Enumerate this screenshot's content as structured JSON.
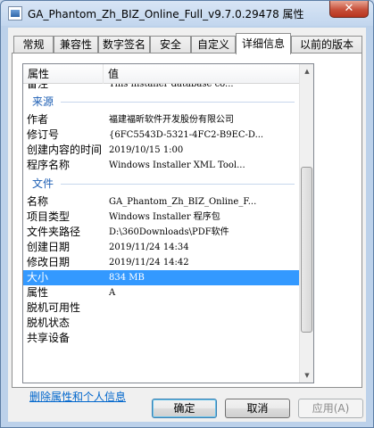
{
  "window": {
    "title": "GA_Phantom_Zh_BIZ_Online_Full_v9.7.0.29478 属性",
    "close_label": "✕"
  },
  "tabs": [
    {
      "label": "常规"
    },
    {
      "label": "兼容性"
    },
    {
      "label": "数字签名"
    },
    {
      "label": "安全"
    },
    {
      "label": "自定义"
    },
    {
      "label": "详细信息",
      "active": true
    },
    {
      "label": "以前的版本"
    }
  ],
  "list": {
    "header": {
      "property": "属性",
      "value": "值"
    },
    "partial_row": {
      "key": "备注",
      "value": "This installer database co..."
    },
    "groups": [
      {
        "name": "来源",
        "rows": [
          {
            "key": "作者",
            "value": "福建福昕软件开发股份有限公司"
          },
          {
            "key": "修订号",
            "value": "{6FC5543D-5321-4FC2-B9EC-D..."
          },
          {
            "key": "创建内容的时间",
            "value": "2019/10/15 1:00"
          },
          {
            "key": "程序名称",
            "value": "Windows Installer XML Tool..."
          }
        ]
      },
      {
        "name": "文件",
        "rows": [
          {
            "key": "名称",
            "value": "GA_Phantom_Zh_BIZ_Online_F..."
          },
          {
            "key": "项目类型",
            "value": "Windows Installer 程序包"
          },
          {
            "key": "文件夹路径",
            "value": "D:\\360Downloads\\PDF软件"
          },
          {
            "key": "创建日期",
            "value": "2019/11/24 14:34"
          },
          {
            "key": "修改日期",
            "value": "2019/11/24 14:42"
          },
          {
            "key": "大小",
            "value": "834 MB",
            "selected": true
          },
          {
            "key": "属性",
            "value": "A"
          },
          {
            "key": "脱机可用性",
            "value": ""
          },
          {
            "key": "脱机状态",
            "value": ""
          },
          {
            "key": "共享设备",
            "value": ""
          }
        ]
      }
    ]
  },
  "links": {
    "remove_properties": "删除属性和个人信息"
  },
  "buttons": {
    "ok": "确定",
    "cancel": "取消",
    "apply": "应用(A)"
  }
}
